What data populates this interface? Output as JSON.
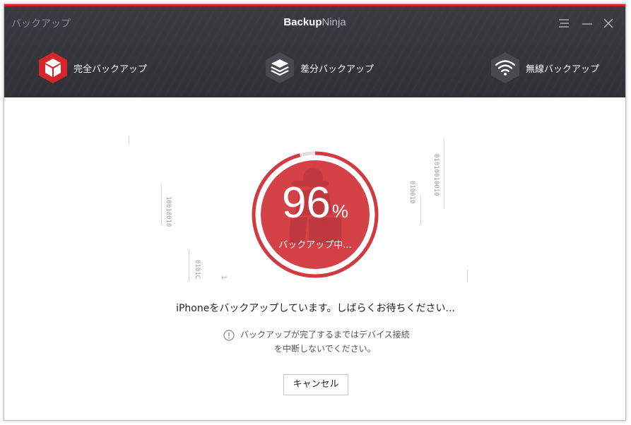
{
  "window": {
    "title": "バックアップ",
    "app_name_bold": "Backup",
    "app_name_light": "Ninja"
  },
  "modes": [
    {
      "label": "完全バックアップ",
      "icon": "box-icon",
      "active": true
    },
    {
      "label": "差分バックアップ",
      "icon": "layers-icon",
      "active": false
    },
    {
      "label": "無線バックアップ",
      "icon": "wifi-icon",
      "active": false
    }
  ],
  "progress": {
    "value": "96",
    "unit": "%",
    "percent": 96,
    "status": "バックアップ中..."
  },
  "binary": {
    "left_a": "10010010",
    "left_b": "0101C",
    "left_c": "1",
    "right_a": "010010",
    "right_b": "01010010010"
  },
  "message": "iPhoneをバックアップしています。しばらくお待ちください...",
  "notice": {
    "line1": "バックアップが完了するまではデバイス接続",
    "line2": "を中断しないでください。"
  },
  "buttons": {
    "cancel": "キャンセル"
  },
  "colors": {
    "accent": "#d7262b",
    "header_bg": "#34363b",
    "ring": "#d33a40",
    "ring_fill": "#d44248"
  }
}
